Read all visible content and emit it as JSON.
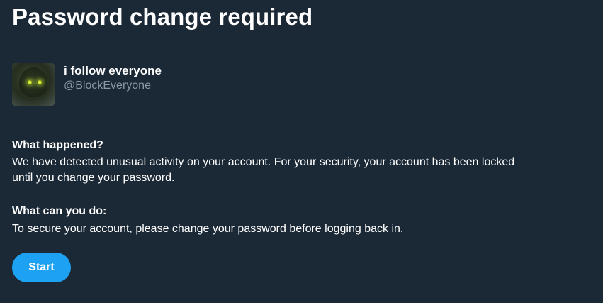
{
  "page": {
    "title": "Password change required"
  },
  "profile": {
    "display_name": "i follow everyone",
    "handle": "@BlockEveryone",
    "avatar_icon": "avatar-glowing-eyes"
  },
  "what_happened": {
    "heading": "What happened?",
    "body": "We have detected unusual activity on your account. For your security, your account has been locked until you change your password."
  },
  "what_can_you_do": {
    "heading": "What can you do:",
    "body": "To secure your account, please change your password before logging back in."
  },
  "actions": {
    "start_label": "Start"
  },
  "colors": {
    "background": "#1b2836",
    "accent": "#1da1f2",
    "secondary_text": "#8b98a5"
  }
}
